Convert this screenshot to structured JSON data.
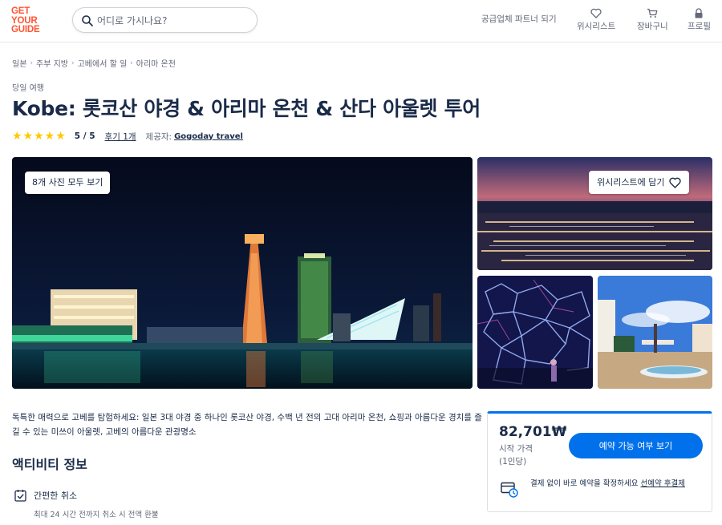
{
  "header": {
    "logo_lines": [
      "GET",
      "YOUR",
      "GUIDE"
    ],
    "search_placeholder": "어디로 가시나요?",
    "partner_link": "공급업체 파트너 되기",
    "wishlist": "위시리스트",
    "cart": "장바구니",
    "profile": "프로필"
  },
  "breadcrumb": [
    "일본",
    "주부 지방",
    "고베에서 할 일",
    "아리마 온천"
  ],
  "category": "당일 여행",
  "title": "Kobe: 롯코산 야경 & 아리마 온천 & 산다 아울렛 투어",
  "rating": {
    "stars": "★★★★★",
    "score": "5 / 5",
    "reviews": "후기 1개",
    "provider_label": "제공자:",
    "provider": "Gogoday travel"
  },
  "gallery": {
    "all_photos": "8개 사진 모두 보기",
    "add_wishlist": "위시리스트에 담기"
  },
  "description": "독특한 매력으로 고베를 탐험하세요: 일본 3대 야경 중 하나인 롯코산 야경, 수백 년 전의 고대 아리마 온천, 쇼핑과 아름다운 경치를 즐길 수 있는 미쓰이 아울렛, 고베의 아름다운 관광명소",
  "activity": {
    "section_title": "액티비티 정보",
    "cancel_title": "간편한 취소",
    "cancel_sub": "최대 24 시간 전까지 취소 시 전액 환불"
  },
  "booking": {
    "price": "82,701₩",
    "price_label": "시작 가격",
    "price_unit": "(1인당)",
    "cta": "예약 가능 여부 보기",
    "reserve_text": "결제 없이 바로 예약을 확정하세요 ",
    "reserve_link": "선예약 후결제"
  },
  "colors": {
    "brand": "#ff5533",
    "accent": "#0071eb",
    "text": "#1a2b49",
    "stars": "#ffc800"
  }
}
